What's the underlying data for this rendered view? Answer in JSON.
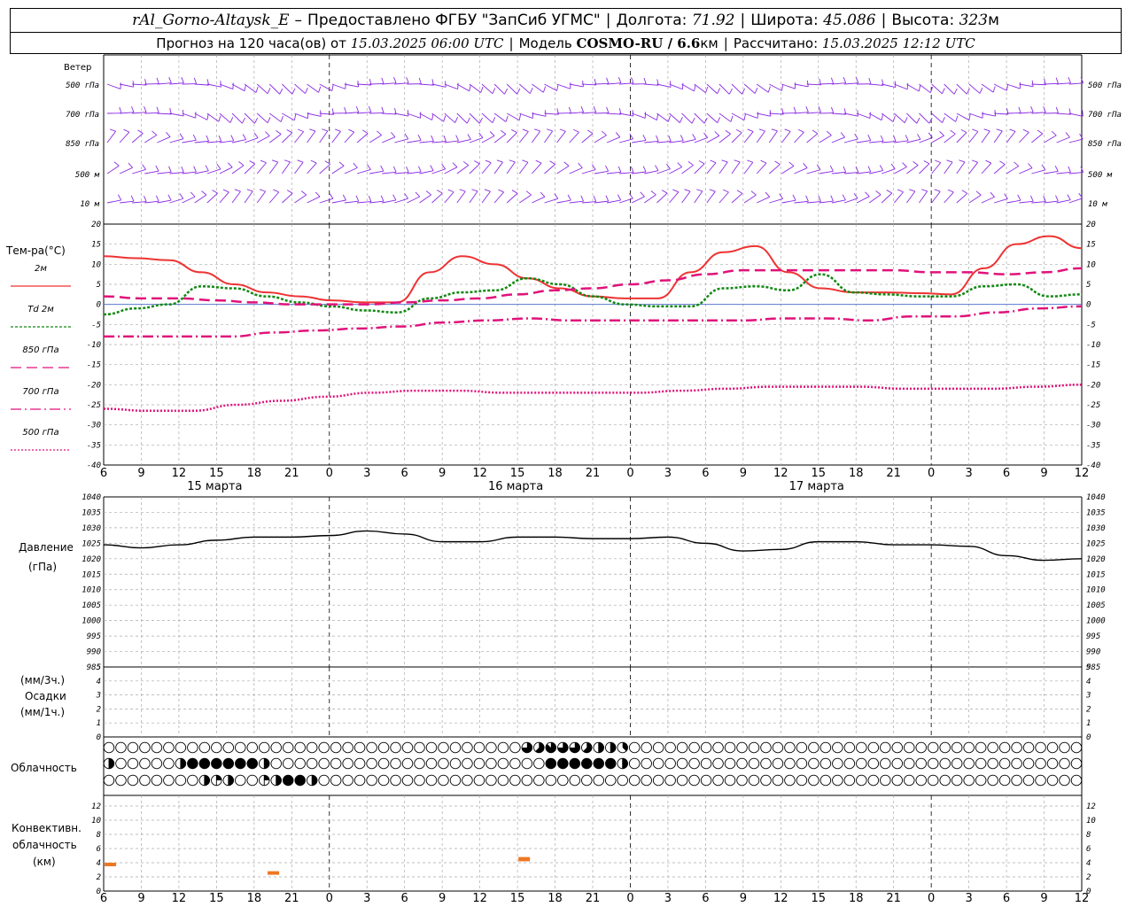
{
  "header": {
    "station": "rAl_Gorno-Altaysk_E",
    "dash": "–",
    "provided": "Предоставлено ФГБУ \"ЗапСиб УГМС\"",
    "lon_label": "Долгота:",
    "lon": "71.92",
    "lat_label": "Широта:",
    "lat": "45.086",
    "alt_label": "Высота:",
    "alt": "323",
    "alt_unit": "м",
    "forecast_label": "Прогноз на 120 часа(ов) от",
    "forecast_start": "15.03.2025 06:00 UTC",
    "model_label": "Модель",
    "model": "COSMO-RU / 6.6",
    "model_unit": "км",
    "calc_label": "Рассчитано:",
    "calc": "15.03.2025 12:12 UTC"
  },
  "wind_panel": {
    "title": "Ветер",
    "levels": [
      "500 гПа",
      "700 гПа",
      "850 гПа",
      "500 м",
      "10  м"
    ]
  },
  "temp_panel": {
    "title": "Тем-ра(°C)",
    "legend": [
      "2м",
      "Td  2м",
      "850 гПа",
      "700 гПа",
      "500 гПа"
    ]
  },
  "pressure_panel": {
    "title": "Давление",
    "unit": "(гПа)"
  },
  "precip_panel": {
    "unit3": "(мм/3ч.)",
    "title": "Осадки",
    "unit1": "(мм/1ч.)"
  },
  "cloud_panel": {
    "title": "Облачность"
  },
  "conv_panel": {
    "title1": "Конвективн.",
    "title2": "облачность",
    "unit": "(км)"
  },
  "day_labels": [
    "15 марта",
    "16 марта",
    "17 марта"
  ],
  "x_ticks": [
    "6",
    "9",
    "12",
    "15",
    "18",
    "21",
    "0",
    "3",
    "6",
    "9",
    "12",
    "15",
    "18",
    "21",
    "0",
    "3",
    "6",
    "9",
    "12",
    "15",
    "18",
    "21",
    "0",
    "3",
    "6",
    "9",
    "12"
  ],
  "colors": {
    "t2m": "#ee3333",
    "td2m": "#118811",
    "t850": "#e0127a",
    "t700": "#e0127a",
    "t500": "#e0127a",
    "wind": "#8a2be2",
    "pressure": "#000000",
    "conv": "#ee7722",
    "zero": "#4466cc"
  },
  "chart_data": [
    {
      "type": "line",
      "name": "temperature",
      "title": "Тем-ра(°C)",
      "x_hours": [
        0,
        3,
        6,
        9,
        12,
        15,
        18,
        21,
        24,
        27,
        30,
        33,
        36,
        39,
        42,
        45,
        48,
        51,
        54,
        57,
        60,
        63,
        66,
        69,
        72,
        75,
        78
      ],
      "ylim": [
        -40,
        20
      ],
      "yticks": [
        20,
        15,
        10,
        5,
        0,
        -5,
        -10,
        -15,
        -20,
        -25,
        -30,
        -35,
        -40
      ],
      "series": [
        {
          "name": "2м",
          "values": [
            12,
            11.5,
            11,
            8,
            5,
            3,
            2,
            1,
            0.5,
            0.5,
            8,
            12,
            10,
            6.5,
            4,
            2,
            1.5,
            1.5,
            8,
            13,
            14.5,
            8,
            4,
            3,
            3,
            2.8,
            2.5,
            9,
            15,
            17,
            14
          ]
        },
        {
          "name": "Td  2м",
          "values": [
            -2.5,
            -1,
            0,
            4.5,
            4,
            2,
            0.5,
            -0.5,
            -1.5,
            -2,
            1.5,
            3,
            3.5,
            6.5,
            5,
            2,
            0,
            -0.5,
            -0.5,
            4,
            4.5,
            3.5,
            7.5,
            3,
            2.5,
            2,
            2,
            4.5,
            5,
            2,
            2.5
          ]
        },
        {
          "name": "850 гПа",
          "values": [
            2,
            1.5,
            1.5,
            1,
            0.5,
            0,
            0,
            0,
            0.5,
            1,
            1.5,
            2.5,
            3.5,
            4,
            5,
            6,
            7.5,
            8.5,
            8.5,
            8.5,
            8.5,
            8.5,
            8,
            8,
            7.5,
            8,
            9
          ]
        },
        {
          "name": "700 гПа",
          "values": [
            -8,
            -8,
            -8,
            -8,
            -7,
            -6.5,
            -6,
            -5.5,
            -4.5,
            -4,
            -3.5,
            -4,
            -4,
            -4,
            -4,
            -4,
            -3.5,
            -3.5,
            -4,
            -3,
            -3,
            -2,
            -1,
            -0.5
          ]
        },
        {
          "name": "500 гПа",
          "values": [
            -26,
            -26.5,
            -26.5,
            -25,
            -24,
            -23,
            -22,
            -21.5,
            -21.5,
            -22,
            -22,
            -22,
            -22,
            -21.5,
            -21,
            -20.5,
            -20.5,
            -20.5,
            -21,
            -21,
            -21,
            -20.5,
            -20
          ]
        }
      ]
    },
    {
      "type": "line",
      "name": "pressure",
      "title": "Давление",
      "ylabel": "(гПа)",
      "ylim": [
        985,
        1040
      ],
      "yticks": [
        1040,
        1035,
        1030,
        1025,
        1020,
        1015,
        1010,
        1005,
        1000,
        995,
        990,
        985
      ],
      "series": [
        {
          "name": "",
          "values": [
            1024.5,
            1023.5,
            1024.5,
            1026,
            1027,
            1027,
            1027.5,
            1029,
            1028,
            1025.5,
            1025.5,
            1027,
            1027,
            1026.5,
            1026.5,
            1027,
            1025,
            1022.5,
            1023,
            1025.5,
            1025.5,
            1024.5,
            1024.5,
            1024,
            1021,
            1019.5,
            1020
          ]
        }
      ]
    },
    {
      "type": "bar",
      "name": "precipitation",
      "title": "Осадки",
      "ylim": [
        0,
        5
      ],
      "yticks": [
        5,
        4,
        3,
        2,
        1,
        0
      ],
      "values": []
    },
    {
      "type": "bar",
      "name": "convective_cloud",
      "title": "Конвективн. облачность",
      "ylabel": "(км)",
      "ylim": [
        0,
        13
      ],
      "yticks": [
        12,
        10,
        8,
        6,
        4,
        2,
        0
      ],
      "segments": [
        {
          "hour": 0.5,
          "base": 3.5,
          "top": 4
        },
        {
          "hour": 13.5,
          "base": 2.3,
          "top": 2.8
        },
        {
          "hour": 33.5,
          "base": 4.2,
          "top": 4.8
        }
      ]
    },
    {
      "type": "table",
      "name": "cloudiness",
      "title": "Облачность",
      "levels": [
        "high",
        "middle",
        "low"
      ],
      "cover_octas": {
        "high": [
          0,
          0,
          0,
          0,
          0,
          0,
          0,
          0,
          0,
          0,
          0,
          0,
          0,
          0,
          0,
          0,
          0,
          0,
          0,
          0,
          0,
          0,
          0,
          0,
          0,
          0,
          0,
          0,
          0,
          0,
          0,
          0,
          0,
          0,
          0,
          6,
          5,
          7,
          6,
          6,
          5,
          4,
          4,
          3,
          0,
          0,
          0,
          0,
          0,
          0,
          0,
          0,
          0,
          0,
          0,
          0,
          0,
          0,
          0,
          0,
          0,
          0,
          0,
          0,
          0,
          0,
          0,
          0,
          0,
          0,
          0,
          0,
          0,
          0,
          0,
          0,
          0,
          0,
          0,
          0,
          0,
          0
        ],
        "middle": [
          4,
          0,
          0,
          0,
          0,
          0,
          4,
          8,
          8,
          8,
          8,
          8,
          8,
          4,
          0,
          0,
          0,
          0,
          0,
          0,
          0,
          0,
          0,
          0,
          0,
          0,
          0,
          0,
          0,
          0,
          0,
          0,
          0,
          0,
          0,
          0,
          0,
          8,
          8,
          8,
          8,
          8,
          8,
          4,
          0,
          0,
          0,
          0,
          0,
          0,
          0,
          0,
          0,
          0,
          0,
          0,
          0,
          0,
          0,
          0,
          0,
          0,
          0,
          0,
          0,
          0,
          0,
          0,
          0,
          0,
          0,
          0,
          0,
          0,
          0,
          0,
          0,
          0,
          0,
          0,
          0,
          0
        ],
        "low": [
          0,
          0,
          0,
          0,
          0,
          0,
          0,
          0,
          4,
          2,
          4,
          0,
          0,
          2,
          4,
          8,
          8,
          4,
          0,
          0,
          0,
          0,
          0,
          0,
          0,
          0,
          0,
          0,
          0,
          0,
          0,
          0,
          0,
          0,
          0,
          0,
          0,
          0,
          0,
          0,
          0,
          0,
          0,
          0,
          0,
          0,
          0,
          0,
          0,
          0,
          0,
          0,
          0,
          0,
          0,
          0,
          0,
          0,
          0,
          0,
          0,
          0,
          0,
          0,
          0,
          0,
          0,
          0,
          0,
          0,
          0,
          0,
          0,
          0,
          0,
          0,
          0,
          0,
          0,
          0,
          0,
          0
        ]
      }
    }
  ]
}
